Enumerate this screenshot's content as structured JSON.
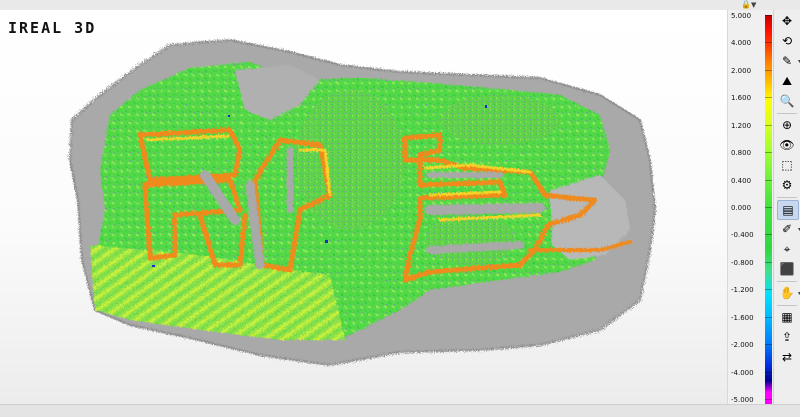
{
  "app": {
    "brand": "IREAL 3D"
  },
  "window": {
    "lock_glyph": "🔒",
    "menu_glyph": "▼"
  },
  "scale": {
    "ticks": [
      "5.000",
      "4.000",
      "2.000",
      "1.600",
      "1.200",
      "0.800",
      "0.400",
      "0.000",
      "-0.400",
      "-0.800",
      "-1.200",
      "-1.600",
      "-2.000",
      "-4.000",
      "-5.000"
    ],
    "max": 5.0,
    "min": -5.0,
    "colors": [
      "#c00000",
      "#ff1000",
      "#ff8000",
      "#ffff00",
      "#a0ff30",
      "#3fe040",
      "#00e0ff",
      "#0080ff",
      "#000090",
      "#ff00ff"
    ]
  },
  "toolbar": {
    "tools": [
      {
        "icon": "move-axes-icon",
        "glyph": "✥"
      },
      {
        "icon": "rotate-icon",
        "glyph": "⟲"
      },
      {
        "icon": "annotate-icon",
        "glyph": "✎"
      },
      {
        "icon": "measure-plane-icon",
        "glyph": "⛰"
      },
      {
        "icon": "zoom-icon",
        "glyph": "🔍"
      },
      {
        "icon": "zoom-fit-icon",
        "glyph": "⊕"
      },
      {
        "icon": "view-icon",
        "glyph": "👁"
      },
      {
        "icon": "cube-view-icon",
        "glyph": "⬚"
      },
      {
        "icon": "settings-icon",
        "glyph": "⚙"
      },
      {
        "icon": "deviation-map-icon",
        "glyph": "▤"
      },
      {
        "icon": "color-probe-icon",
        "glyph": "✐"
      },
      {
        "icon": "pick-point-icon",
        "glyph": "⌖"
      },
      {
        "icon": "brush-icon",
        "glyph": "⬛"
      },
      {
        "icon": "hand-pan-icon",
        "glyph": "✋"
      },
      {
        "icon": "report-icon",
        "glyph": "▦"
      },
      {
        "icon": "export-icon",
        "glyph": "⇪"
      },
      {
        "icon": "share-icon",
        "glyph": "⇄"
      }
    ]
  }
}
